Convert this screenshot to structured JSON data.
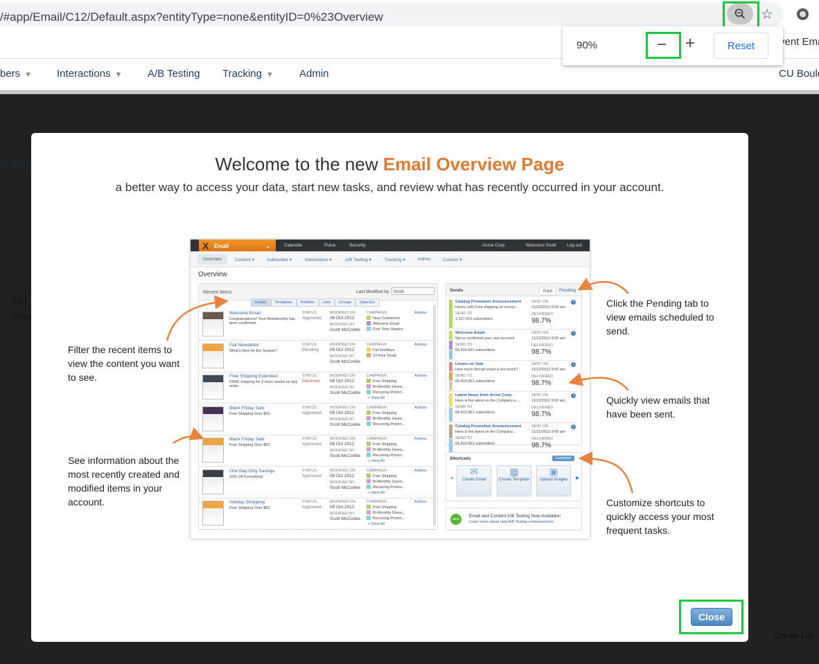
{
  "browser": {
    "url": "/#app/Email/C12/Default.aspx?entityType=none&entityID=0%23Overview",
    "zoom_icon": "zoom-out-magnifier-icon",
    "bookmark_partial": "vent Ema",
    "zoom_popup": {
      "level": "90%",
      "minus": "−",
      "plus": "+",
      "reset": "Reset"
    }
  },
  "nav": {
    "items": [
      {
        "label": "bers",
        "caret": true
      },
      {
        "label": "Interactions",
        "caret": true
      },
      {
        "label": "A/B Testing",
        "caret": false
      },
      {
        "label": "Tracking",
        "caret": true
      },
      {
        "label": "Admin",
        "caret": false
      }
    ],
    "org": "CU Bould"
  },
  "background": {
    "tab_partial": "er Emai",
    "empty_title": "No i",
    "empty_text": "Once",
    "create_list": "Create List"
  },
  "modal": {
    "title_prefix": "Welcome to the new ",
    "title_highlight": "Email Overview Page",
    "subtitle": "a better way to access your data, start new tasks, and review what has recently occurred in your account.",
    "annotations": {
      "filter": "Filter the recent items to view the content you want to see.",
      "info": "See information about the most recently created and modified items in your account.",
      "pending": "Click the Pending tab to view emails scheduled to send.",
      "sent": "Quickly view emails that have been sent.",
      "shortcuts": "Customize shortcuts to quickly access your most frequent tasks."
    },
    "close": "Close",
    "accent": "#e07a2e",
    "highlight_box": "#19c83c"
  },
  "shot": {
    "brand": "Email",
    "topnav": [
      "Calendar",
      "Pulse",
      "Security"
    ],
    "account": "Acme Corp",
    "welcome": "Welcome Scott",
    "logout": "Log out",
    "subnav": [
      "Overview",
      "Content ▾",
      "Subscriber ▾",
      "Interactions ▾",
      "A/B Testing ▾",
      "Tracking ▾",
      "Admin",
      "Custom ▾"
    ],
    "page_title": "Overview",
    "recent": {
      "title": "Recent Items",
      "filter_label": "Last Modified by",
      "filter_value": "Scott",
      "tabs": [
        "Emails",
        "Templates",
        "Portfolio",
        "Lists",
        "Groups",
        "Data Ext."
      ],
      "labels": {
        "status": "STATUS",
        "modified_on": "MODIFIED ON",
        "modified_by": "MODIFIED BY",
        "campaign": "CAMPAIGN",
        "actions": "Actions",
        "view_all": "+ View All"
      },
      "rows": [
        {
          "title": "Welcome Email",
          "desc": "Congratulations! Your Membership has been confirmed.",
          "status": "Approved",
          "date": "08 Oct 2012",
          "by": "Scott McCorkle",
          "campaigns": [
            [
              "New Customers",
              "#b5d46a"
            ],
            [
              "Welcome Email",
              "#a98bd6"
            ],
            [
              "First Time Visitors",
              "#8ec9e8"
            ]
          ],
          "view_all": false,
          "thumb": "#6a5a48"
        },
        {
          "title": "Fall Newsletter",
          "desc": "What's New for the Season?",
          "status": "Pending",
          "date": "08 Oct 2012",
          "by": "Scott McCorkle",
          "campaigns": [
            [
              "Fall Holidays",
              "#e8d56a"
            ],
            [
              "12-hour Deals",
              "#e8a65a"
            ]
          ],
          "view_all": false,
          "thumb": "#f0a640"
        },
        {
          "title": "Free Shipping Extended",
          "desc": "FREE shipping for 2 more weeks on any order.",
          "status": "Declined",
          "date": "08 Oct 2012",
          "by": "Scott McCorkle",
          "campaigns": [
            [
              "Free Shipping",
              "#b5c96a"
            ],
            [
              "Bi-Monthly Givea...",
              "#d39ae0"
            ],
            [
              "Recurring Promo...",
              "#7fd3cf"
            ]
          ],
          "view_all": true,
          "thumb": "#3d4a55"
        },
        {
          "title": "Black Friday Sale",
          "desc": "Free Shipping Over $50",
          "status": "Approved",
          "date": "08 Oct 2012",
          "by": "Scott McCorkle",
          "campaigns": [
            [
              "Free Shipping",
              "#b5c96a"
            ],
            [
              "Bi-Monthly Givea...",
              "#d39ae0"
            ],
            [
              "Recurring Promo...",
              "#7fd3cf"
            ]
          ],
          "view_all": false,
          "thumb": "#4a3050"
        },
        {
          "title": "Black Friday Sale",
          "desc": "Free Shipping Over $50",
          "status": "Approved",
          "date": "08 Oct 2012",
          "by": "Scott McCorkle",
          "campaigns": [
            [
              "Free Shipping",
              "#b5c96a"
            ],
            [
              "Bi-Monthly Givea...",
              "#d39ae0"
            ],
            [
              "Recurring Promo...",
              "#7fd3cf"
            ]
          ],
          "view_all": true,
          "thumb": "#f0a640"
        },
        {
          "title": "One Day Only Savings",
          "desc": "10% Off Everything!",
          "status": "Approved",
          "date": "08 Oct 2012",
          "by": "Scott McCorkle",
          "campaigns": [
            [
              "Free Shipping",
              "#b5c96a"
            ],
            [
              "Bi-Monthly Givea...",
              "#d39ae0"
            ],
            [
              "Recurring Promo...",
              "#7fd3cf"
            ]
          ],
          "view_all": true,
          "thumb": "#3a3f48"
        },
        {
          "title": "Holiday Shopping",
          "desc": "Free Shipping Over $50",
          "status": "Approved",
          "date": "08 Oct 2012",
          "by": "Scott McCorkle",
          "campaigns": [
            [
              "Free Shipping",
              "#b5c96a"
            ],
            [
              "Bi-Monthly Givea...",
              "#d39ae0"
            ],
            [
              "Recurring Promo...",
              "#7fd3cf"
            ]
          ],
          "view_all": true,
          "thumb": "#f0a640"
        }
      ]
    },
    "sends": {
      "title": "Sends",
      "tabs": [
        "Past",
        "Pending"
      ],
      "labels": {
        "send_to": "SEND TO",
        "sent_on": "SENT ON",
        "delivered": "DELIVERED"
      },
      "rows": [
        {
          "title": "Catalog Promotion Announcement",
          "desc": "Hours Left! Free shipping on everyt...",
          "to": "1,237,410 subscribers",
          "sent": "11/12/2012 9:00 am",
          "delivered": "98.7%",
          "colors": [
            "#b5d46a"
          ]
        },
        {
          "title": "Welcome Email",
          "desc": "We've confirmed your new account.",
          "to": "65,410,961 subscribers",
          "sent": "11/12/2012 9:00 am",
          "delivered": "98.7%",
          "colors": [
            "#c2e060",
            "#a98bd6",
            "#8ec9e8"
          ]
        },
        {
          "title": "Linens on Sale",
          "desc": "How much thread count is too much?",
          "to": "65,410,961 subscribers",
          "sent": "11/12/2012 9:00 am",
          "delivered": "98.7%",
          "colors": [
            "#e08a8a",
            "#e8a65a",
            "#d9c7a8"
          ]
        },
        {
          "title": "Latest News from Acme Corp.",
          "desc": "Here is the latest on the Company e...",
          "to": "65,410,961 subscribers",
          "sent": "11/12/2012 9:00 am",
          "delivered": "98.7%",
          "colors": [
            "#e8de78",
            "#9ccbe8"
          ]
        },
        {
          "title": "Catalog Promotion Announcement",
          "desc": "Here is the latest on the Company...",
          "to": "65,410,961 subscribers",
          "sent": "11/12/2012 9:00 am",
          "delivered": "98.7%",
          "colors": [
            "#bba88a",
            "#9ccbe8"
          ]
        }
      ]
    },
    "shortcuts": {
      "title": "Shortcuts",
      "customize": "Customize",
      "items": [
        "Create Email",
        "Create Template",
        "Upload Images"
      ]
    },
    "banner": {
      "badge": "NEW",
      "headline": "Email and Content A/B Testing Now Available!",
      "link": "Learn more about new A/B Testing enhancements."
    }
  }
}
